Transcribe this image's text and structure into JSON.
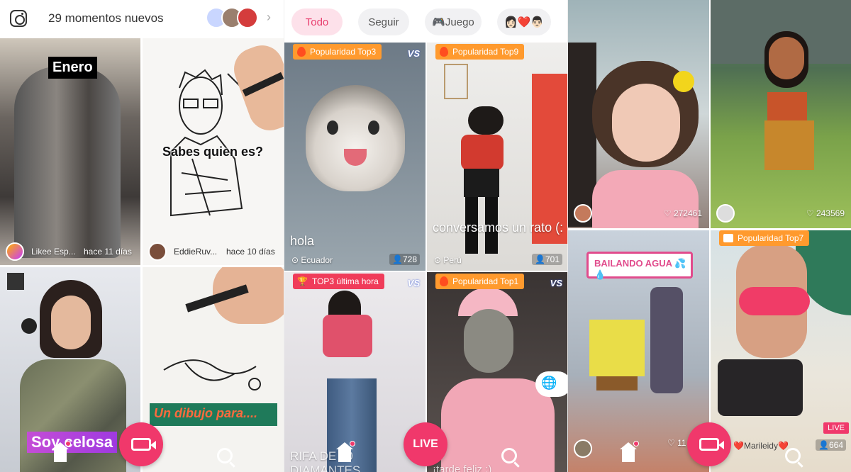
{
  "panel1": {
    "moments_text": "29 momentos nuevos",
    "tiles": [
      {
        "caption": "Enero",
        "user": "Likee Esp...",
        "time": "hace 11 días"
      },
      {
        "caption": "Sabes quien es?",
        "user": "EddieRuv...",
        "time": "hace 10 días"
      },
      {
        "caption": "Soy celosa"
      },
      {
        "caption": "Un dibujo para...."
      }
    ]
  },
  "panel2": {
    "tabs": [
      "Todo",
      "Seguir",
      "🎮Juego",
      "👩🏻❤️👨🏻"
    ],
    "tiles": [
      {
        "badge": "Popularidad Top3",
        "vs": "VS",
        "caption": "hola",
        "location": "Ecuador",
        "viewers": "728"
      },
      {
        "badge": "Popularidad Top9",
        "caption": "conversamos un rato (:",
        "location": "Perú",
        "viewers": "701"
      },
      {
        "badge": "TOP3 última hora",
        "vs": "VS",
        "caption": "RIFA DE 10 DIAMANTES"
      },
      {
        "badge": "Popularidad Top1",
        "vs": "VS",
        "caption": "¡tarde feliz :)"
      }
    ],
    "live_label": "LIVE"
  },
  "panel3": {
    "tiles": [
      {
        "likes": "272461"
      },
      {
        "likes": "243569"
      },
      {
        "caption": "BAILANDO AGUA 💦💧",
        "likes": "11"
      },
      {
        "badge": "Popularidad Top7",
        "user": "❤️Marileidy❤️",
        "live_tag": "LIVE",
        "viewers": "664"
      }
    ]
  }
}
